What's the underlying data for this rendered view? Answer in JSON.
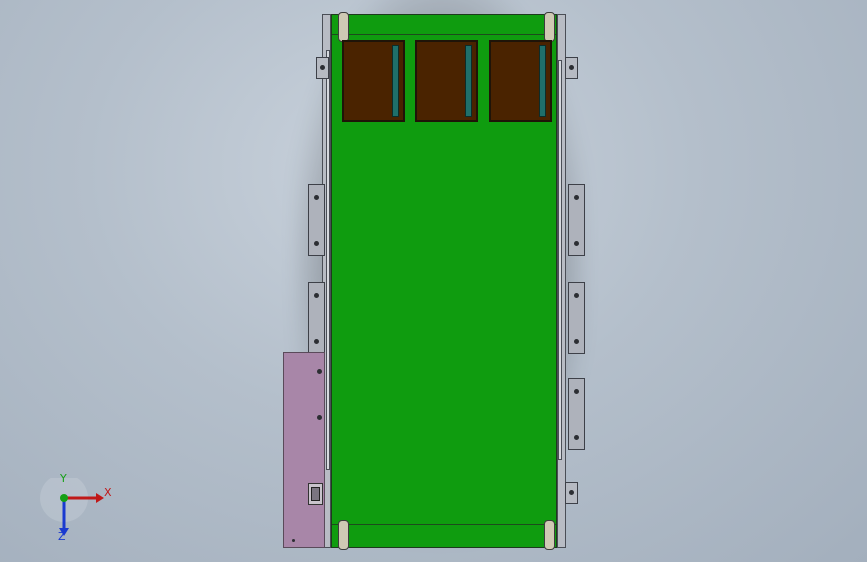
{
  "viewport": {
    "background_top": "#c9d2dc",
    "background_bottom": "#a3afbd"
  },
  "model": {
    "belt_color": "#0f9c0f",
    "box_color": "#4a2300",
    "glass_color": "#1f6f6a",
    "motor_plate_color": "#a886a8",
    "rail_color": "#b8bcc4",
    "box_count": 3
  },
  "triad": {
    "x_label": "X",
    "y_label": "Y",
    "z_label": "Z",
    "x_color": "#c01818",
    "y_color": "#16a016",
    "z_color": "#1a3ad0"
  }
}
